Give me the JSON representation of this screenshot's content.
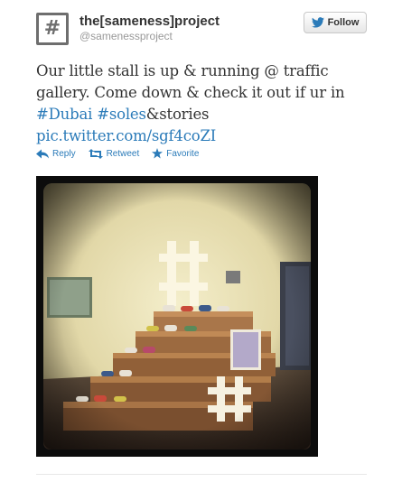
{
  "profile": {
    "avatar_glyph": "#",
    "name": "the[sameness]project",
    "handle": "@samenessproject"
  },
  "follow_button": {
    "label": "Follow",
    "icon": "twitter-bird-icon",
    "color": "#2b7bb9"
  },
  "tweet": {
    "text_line1": "Our little stall is up & running @ traffic",
    "text_line2": "gallery. Come down & check it out if ur in",
    "hashtag_dubai": "#Dubai",
    "hashtag_soles": "#soles",
    "text_suffix": "&stories",
    "link": "pic.twitter.com/sgf4coZI"
  },
  "actions": [
    {
      "label": "Reply",
      "icon": "reply-arrow-icon"
    },
    {
      "label": "Retweet",
      "icon": "retweet-icon"
    },
    {
      "label": "Favorite",
      "icon": "star-icon"
    }
  ],
  "media": {
    "icon": "photo-of-sneaker-stall-on-pallets"
  },
  "colors": {
    "link": "#2b7bb9",
    "text": "#333333",
    "meta": "#999999"
  }
}
